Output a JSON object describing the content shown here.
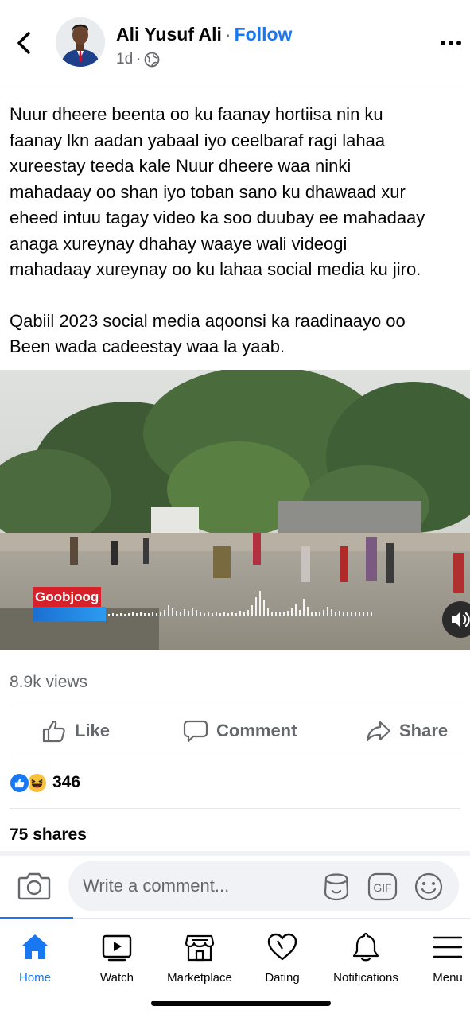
{
  "header": {
    "author_name": "Ali Yusuf Ali",
    "separator": "·",
    "follow_label": "Follow",
    "time": "1d",
    "meta_sep": "·"
  },
  "post": {
    "paragraph1": "Nuur dheere beenta oo ku faanay hortiisa nin ku\nfaanay lkn aadan yabaal iyo ceelbaraf ragi lahaa\nxureestay teeda kale Nuur dheere waa ninki\nmahadaay oo shan iyo toban sano ku dhawaad xur\neheed intuu tagay video ka soo duubay ee mahadaay\nanaga xureynay dhahay waaye wali videogi\nmahadaay xureynay oo ku lahaa social media ku jiro.",
    "paragraph2": "Qabiil 2023 social media aqoonsi ka raadinaayo oo\nBeen wada cadeestay waa la yaab."
  },
  "video": {
    "watermark": "Goobjoog"
  },
  "stats": {
    "views": "8.9k views",
    "reaction_count": "346",
    "shares": "75 shares"
  },
  "actions": {
    "like": "Like",
    "comment": "Comment",
    "share": "Share"
  },
  "comment_bar": {
    "placeholder": "Write a comment...",
    "gif_label": "GIF"
  },
  "nav": {
    "items": [
      {
        "label": "Home",
        "icon": "home-icon",
        "active": true
      },
      {
        "label": "Watch",
        "icon": "watch-icon"
      },
      {
        "label": "Marketplace",
        "icon": "marketplace-icon"
      },
      {
        "label": "Dating",
        "icon": "dating-icon"
      },
      {
        "label": "Notifications",
        "icon": "bell-icon"
      },
      {
        "label": "Menu",
        "icon": "menu-icon"
      }
    ]
  },
  "colors": {
    "accent": "#1877f2",
    "secondary_text": "#65676b",
    "haha": "#f7c23a",
    "watermark_red": "#d6202a"
  }
}
